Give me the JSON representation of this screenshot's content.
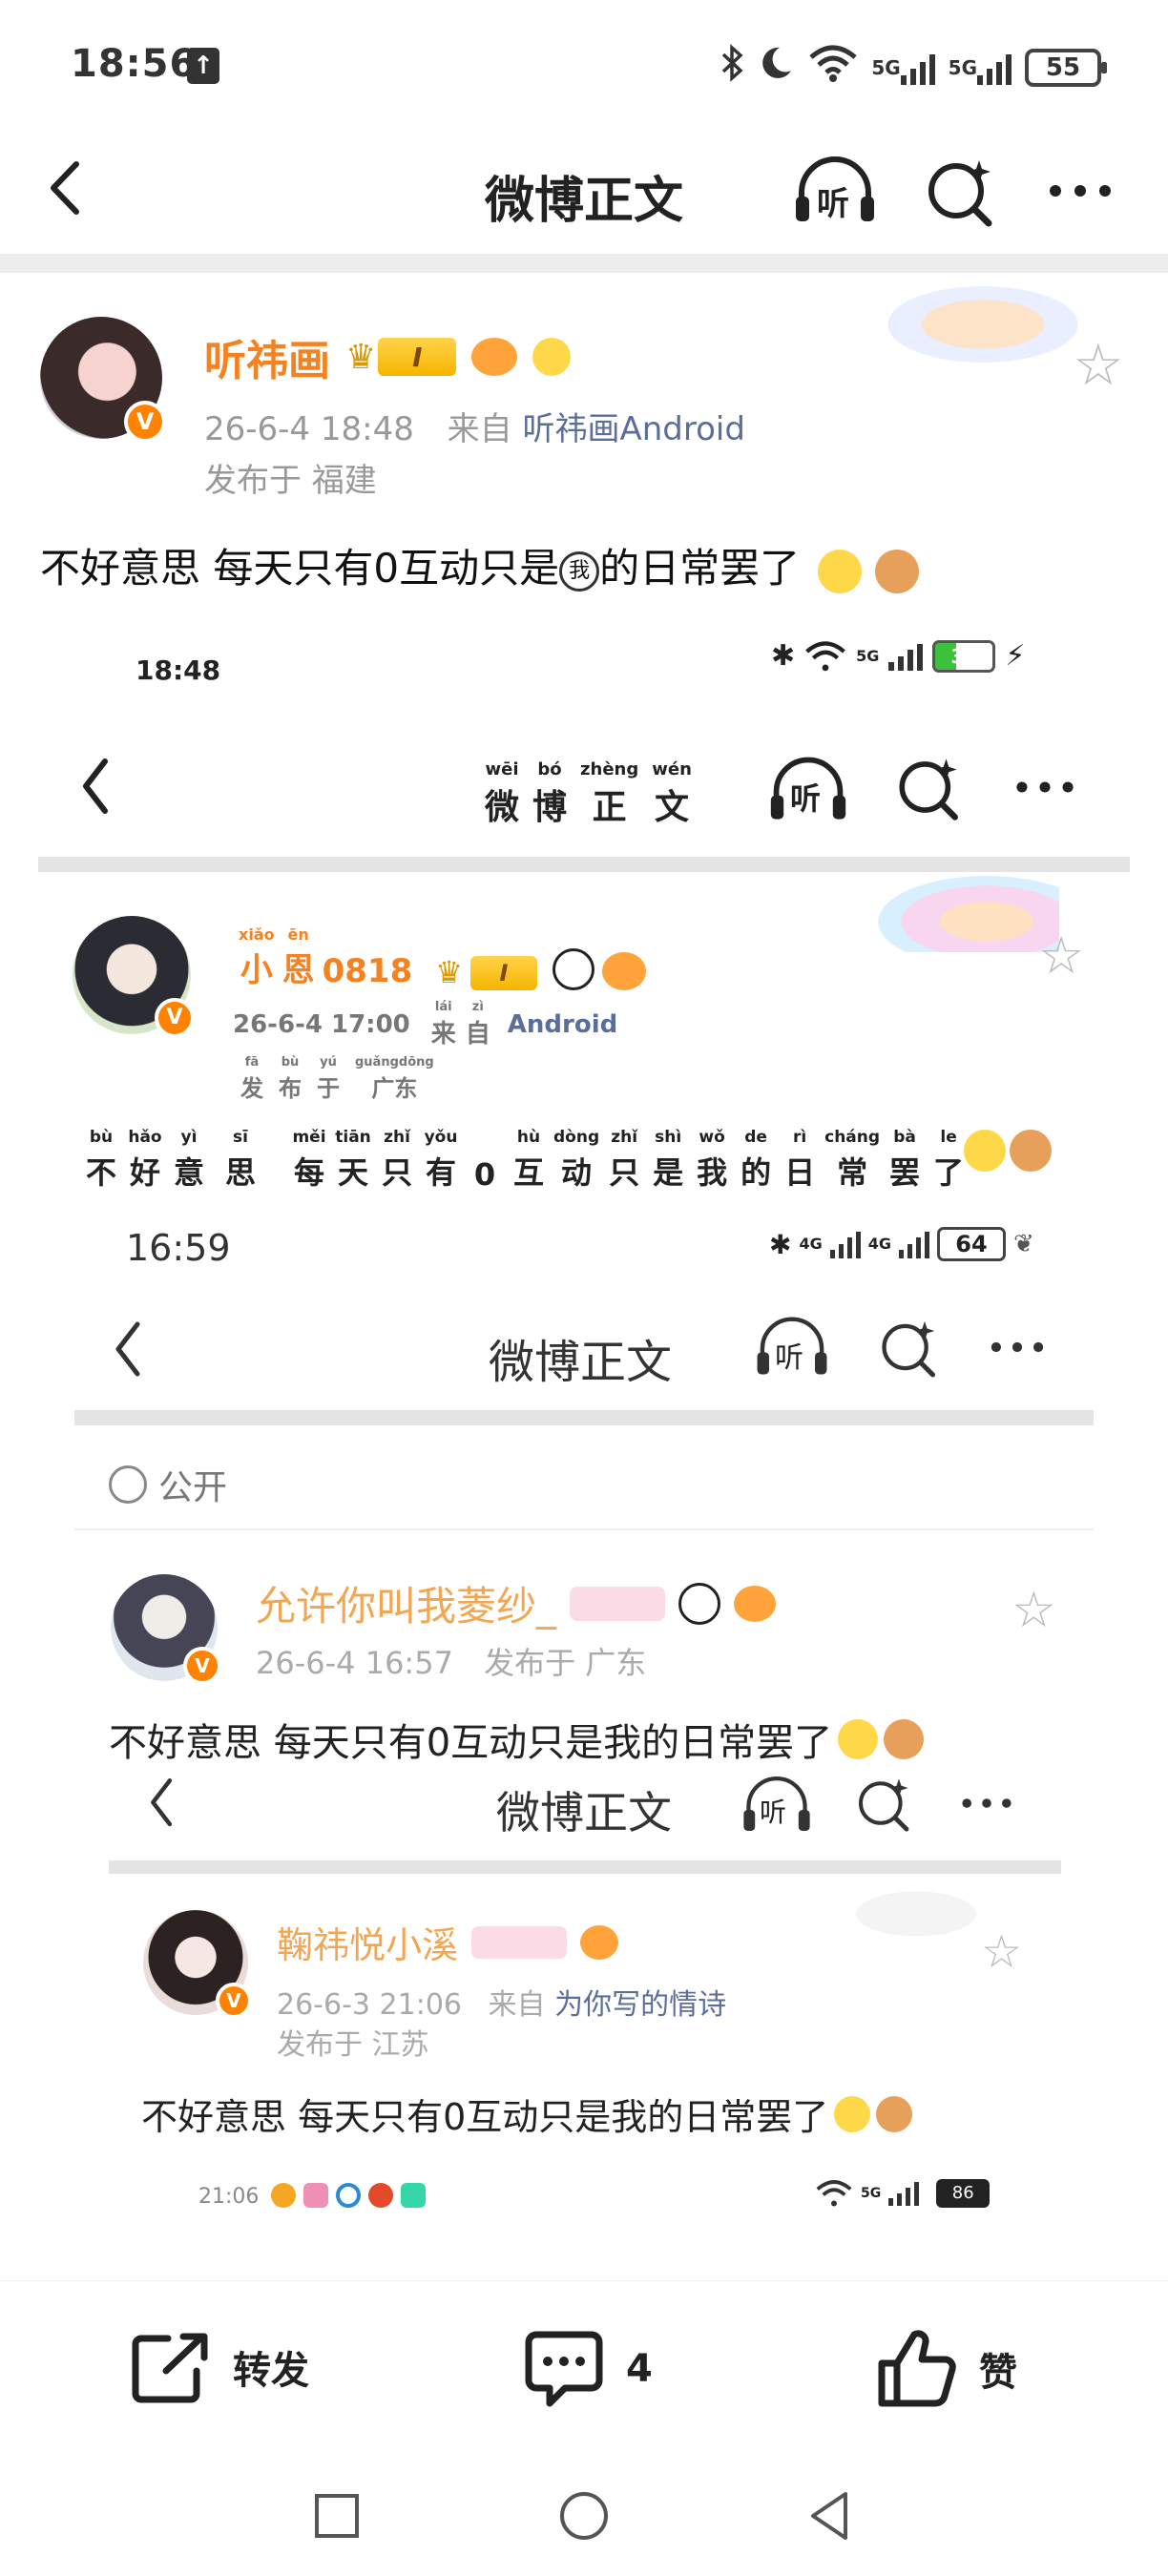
{
  "status_bar": {
    "time": "18:56",
    "network_1": "5G",
    "network_2": "5G",
    "battery": "55"
  },
  "nav": {
    "title": "微博正文",
    "listen_label": "听"
  },
  "post": {
    "username": "听祎画",
    "level": "I",
    "timestamp": "26-6-4 18:48",
    "from_label": "来自",
    "source": "听祎画Android",
    "location": "发布于 福建",
    "text_a": "不好意思 每天只有0互动只是",
    "text_emoji": "我",
    "text_b": "的日常罢了"
  },
  "shot1": {
    "time": "18:48",
    "network": "5G",
    "battery": "37",
    "title_pinyin": [
      "wēi",
      "bó",
      "zhèng",
      "wén"
    ],
    "title_chars": [
      "微",
      "博",
      "正",
      "文"
    ],
    "listen_label": "听",
    "username_pinyin": [
      "xiǎo",
      "ēn"
    ],
    "username": "小恩0818",
    "username_chars": [
      "小",
      "恩",
      "0818"
    ],
    "level": "I",
    "timestamp": "26-6-4 17:00",
    "from_chars": [
      "来",
      "自"
    ],
    "from_pinyin": [
      "lái",
      "zì"
    ],
    "source": "Android",
    "location_chars": [
      "发",
      "布",
      "于",
      "广东"
    ],
    "location_pinyin": [
      "fā",
      "bù",
      "yú",
      "guǎngdōng"
    ],
    "text_pinyin": [
      "bù",
      "hǎo",
      "yì",
      "sī",
      "měi",
      "tiān",
      "zhǐ",
      "yǒu",
      "",
      "hù",
      "dòng",
      "zhǐ",
      "shì",
      "wǒ",
      "de",
      "rì",
      "cháng",
      "bà",
      "le"
    ],
    "text_chars": [
      "不",
      "好",
      "意",
      "思",
      "每",
      "天",
      "只",
      "有",
      "0",
      "互",
      "动",
      "只",
      "是",
      "我",
      "的",
      "日",
      "常",
      "罢",
      "了"
    ]
  },
  "shot2": {
    "time": "16:59",
    "network_1": "4G",
    "network_2": "4G",
    "battery": "64",
    "title": "微博正文",
    "listen_label": "听",
    "visibility": "公开",
    "username": "允许你叫我菱纱_",
    "timestamp": "26-6-4 16:57",
    "location": "发布于 广东",
    "text": "不好意思 每天只有0互动只是我的日常罢了"
  },
  "shot3": {
    "title": "微博正文",
    "listen_label": "听",
    "username": "鞠祎悦小溪",
    "timestamp": "26-6-3 21:06",
    "from_label": "来自",
    "source": "为你写的情诗",
    "location": "发布于 江苏",
    "text": "不好意思 每天只有0互动只是我的日常罢了"
  },
  "shot4": {
    "time": "21:06",
    "network": "5G",
    "battery": "86"
  },
  "actions": {
    "repost_label": "转发",
    "comment_count": "4",
    "like_label": "赞"
  },
  "colors": {
    "accent_orange": "#f58220",
    "link_blue": "#5b6e9a",
    "meta_gray": "#999999"
  }
}
